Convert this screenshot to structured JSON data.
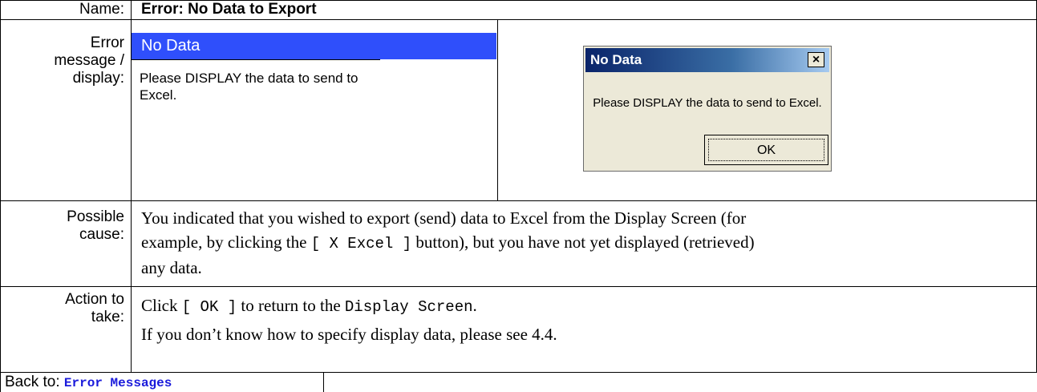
{
  "name_row": {
    "label": "Name:",
    "value": "Error: No Data to Export"
  },
  "error_row": {
    "label_lines": [
      "Error",
      "message /",
      "display:"
    ],
    "mock_title": "No Data",
    "mock_body": "Please DISPLAY the data to send to Excel.",
    "dialog": {
      "title": "No Data",
      "close": "×",
      "message": "Please DISPLAY the data to send to Excel.",
      "ok": "OK"
    }
  },
  "cause_row": {
    "label_lines": [
      "Possible",
      "cause:"
    ],
    "text_1": "You indicated that you wished to export (send) data to Excel from the Display Screen (for",
    "text_2a": "example, by clicking the ",
    "text_2b": "[ X Excel ]",
    "text_2c": " button), but you have not yet displayed (retrieved)",
    "text_3": "any data."
  },
  "action_row": {
    "label_lines": [
      "Action to",
      "take:"
    ],
    "line1a": "Click ",
    "line1b": "[ OK ]",
    "line1c": " to return to the ",
    "line1d": "Display Screen",
    "line1e": ".",
    "line2": "If you don’t know how to specify display data, please see 4.4."
  },
  "back_row": {
    "label": "Back to: ",
    "link": "Error Messages"
  }
}
